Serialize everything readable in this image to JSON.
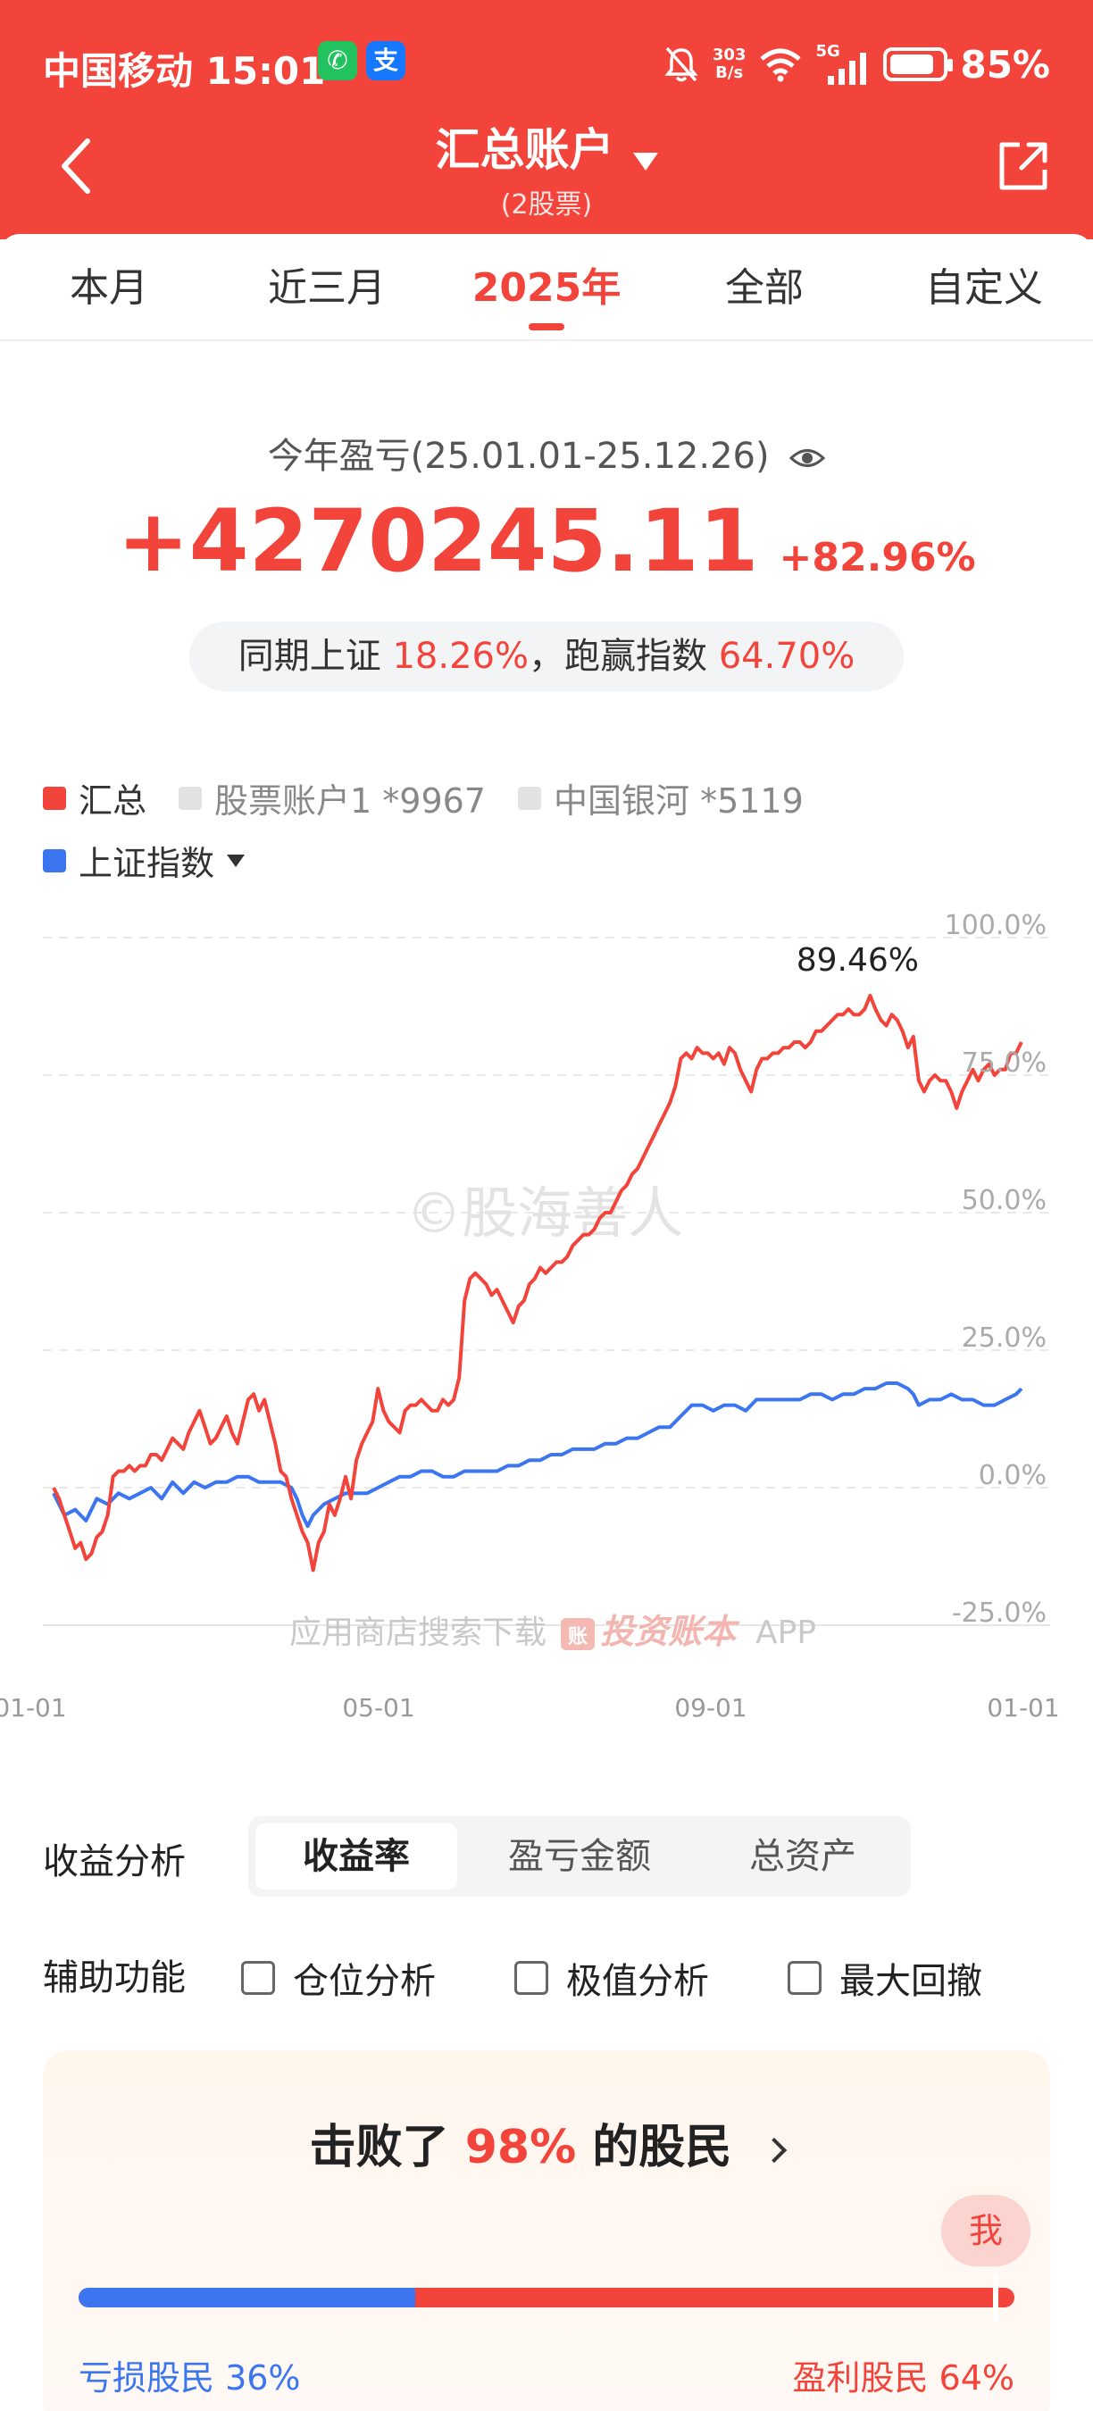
{
  "status_bar": {
    "carrier": "中国移动",
    "time": "15:01",
    "net_speed_value": "303",
    "net_speed_unit": "B/s",
    "network_type": "5G",
    "battery_percent": "85%",
    "battery_level": 0.85,
    "icons": [
      "wechat-icon",
      "alipay-icon",
      "mute-bell-icon",
      "wifi-icon",
      "signal-icon",
      "battery-icon"
    ]
  },
  "nav": {
    "title": "汇总账户",
    "subtitle": "(2股票)",
    "wechat_glyph": "✆",
    "alipay_glyph": "支"
  },
  "tabs": [
    {
      "label": "本月"
    },
    {
      "label": "近三月"
    },
    {
      "label": "2025年",
      "active": true
    },
    {
      "label": "全部"
    },
    {
      "label": "自定义"
    }
  ],
  "summary": {
    "period_label": "今年盈亏(25.01.01-25.12.26)",
    "profit_amount": "+4270245.11",
    "profit_percent": "+82.96%",
    "compare_prefix": "同期上证",
    "index_return": "18.26%",
    "compare_mid": "，跑赢指数",
    "outperform": "64.70%"
  },
  "legend": {
    "total_label": "汇总",
    "account1_label": "股票账户1 *9967",
    "account2_label": "中国银河 *5119",
    "index_label": "上证指数"
  },
  "colors": {
    "brand_red": "#f2443a",
    "index_blue": "#3b76f0",
    "muted_grey": "#dddddd"
  },
  "chart_data": {
    "type": "line",
    "title": "",
    "xlabel": "",
    "ylabel": "",
    "x_ticks": [
      "01-01",
      "05-01",
      "09-01",
      "01-01"
    ],
    "y_ticks": [
      "100.0%",
      "75.0%",
      "50.0%",
      "25.0%",
      "0.0%",
      "-25.0%"
    ],
    "ylim": [
      -25,
      100
    ],
    "x_domain": [
      0,
      360
    ],
    "peak_label": "89.46%",
    "peak_value": 89.46,
    "peak_day": 302,
    "watermark": "©股海善人",
    "promo_text": "应用商店搜索下载",
    "promo_brand": "投资账本",
    "promo_suffix": "APP",
    "promo_badge": "账",
    "series": [
      {
        "name": "汇总",
        "color": "#f2443a",
        "points": [
          [
            0,
            0
          ],
          [
            2,
            -2
          ],
          [
            4,
            -5
          ],
          [
            6,
            -8
          ],
          [
            8,
            -11
          ],
          [
            10,
            -10
          ],
          [
            12,
            -13
          ],
          [
            14,
            -12
          ],
          [
            16,
            -9
          ],
          [
            18,
            -8
          ],
          [
            20,
            -5
          ],
          [
            22,
            2
          ],
          [
            24,
            3
          ],
          [
            26,
            3
          ],
          [
            28,
            4
          ],
          [
            30,
            3
          ],
          [
            32,
            4
          ],
          [
            34,
            4
          ],
          [
            36,
            6
          ],
          [
            38,
            6
          ],
          [
            40,
            5
          ],
          [
            42,
            7
          ],
          [
            44,
            9
          ],
          [
            46,
            8
          ],
          [
            48,
            7
          ],
          [
            50,
            10
          ],
          [
            52,
            12
          ],
          [
            54,
            14
          ],
          [
            56,
            11
          ],
          [
            58,
            8
          ],
          [
            60,
            9
          ],
          [
            62,
            11
          ],
          [
            64,
            13
          ],
          [
            66,
            10
          ],
          [
            68,
            8
          ],
          [
            70,
            12
          ],
          [
            72,
            16
          ],
          [
            74,
            17
          ],
          [
            76,
            14
          ],
          [
            78,
            16
          ],
          [
            80,
            12
          ],
          [
            82,
            8
          ],
          [
            84,
            3
          ],
          [
            86,
            2
          ],
          [
            88,
            -2
          ],
          [
            90,
            -5
          ],
          [
            92,
            -8
          ],
          [
            94,
            -10
          ],
          [
            96,
            -15
          ],
          [
            98,
            -10
          ],
          [
            100,
            -8
          ],
          [
            102,
            -3
          ],
          [
            104,
            -5
          ],
          [
            106,
            -2
          ],
          [
            108,
            2
          ],
          [
            110,
            -2
          ],
          [
            112,
            5
          ],
          [
            114,
            8
          ],
          [
            116,
            10
          ],
          [
            118,
            12
          ],
          [
            120,
            18
          ],
          [
            122,
            14
          ],
          [
            124,
            12
          ],
          [
            126,
            11
          ],
          [
            128,
            10
          ],
          [
            130,
            14
          ],
          [
            132,
            15
          ],
          [
            134,
            15
          ],
          [
            136,
            16
          ],
          [
            138,
            15
          ],
          [
            140,
            14
          ],
          [
            142,
            14
          ],
          [
            144,
            16
          ],
          [
            146,
            15
          ],
          [
            148,
            16
          ],
          [
            150,
            20
          ],
          [
            152,
            34
          ],
          [
            154,
            38
          ],
          [
            156,
            39
          ],
          [
            158,
            38
          ],
          [
            160,
            37
          ],
          [
            162,
            35
          ],
          [
            164,
            36
          ],
          [
            166,
            34
          ],
          [
            168,
            32
          ],
          [
            170,
            30
          ],
          [
            172,
            33
          ],
          [
            174,
            34
          ],
          [
            176,
            37
          ],
          [
            178,
            38
          ],
          [
            180,
            40
          ],
          [
            182,
            39
          ],
          [
            184,
            40
          ],
          [
            186,
            41
          ],
          [
            188,
            41
          ],
          [
            190,
            42
          ],
          [
            192,
            44
          ],
          [
            194,
            45
          ],
          [
            196,
            46
          ],
          [
            198,
            46
          ],
          [
            200,
            47
          ],
          [
            202,
            49
          ],
          [
            204,
            50
          ],
          [
            206,
            50
          ],
          [
            208,
            52
          ],
          [
            210,
            54
          ],
          [
            212,
            55
          ],
          [
            214,
            57
          ],
          [
            216,
            58
          ],
          [
            218,
            60
          ],
          [
            220,
            62
          ],
          [
            222,
            64
          ],
          [
            224,
            66
          ],
          [
            226,
            68
          ],
          [
            228,
            70
          ],
          [
            230,
            73
          ],
          [
            232,
            78
          ],
          [
            234,
            79
          ],
          [
            236,
            78
          ],
          [
            238,
            80
          ],
          [
            240,
            79
          ],
          [
            242,
            79
          ],
          [
            244,
            78
          ],
          [
            246,
            79
          ],
          [
            248,
            77
          ],
          [
            250,
            80
          ],
          [
            252,
            79
          ],
          [
            254,
            76
          ],
          [
            256,
            74
          ],
          [
            258,
            72
          ],
          [
            260,
            76
          ],
          [
            262,
            78
          ],
          [
            264,
            78
          ],
          [
            266,
            79
          ],
          [
            268,
            79
          ],
          [
            270,
            80
          ],
          [
            272,
            80
          ],
          [
            274,
            81
          ],
          [
            276,
            81
          ],
          [
            278,
            80
          ],
          [
            280,
            81
          ],
          [
            282,
            83
          ],
          [
            284,
            83
          ],
          [
            286,
            84
          ],
          [
            288,
            85
          ],
          [
            290,
            86
          ],
          [
            292,
            86
          ],
          [
            294,
            87
          ],
          [
            296,
            86
          ],
          [
            298,
            86
          ],
          [
            300,
            87
          ],
          [
            302,
            89.46
          ],
          [
            304,
            87
          ],
          [
            306,
            85
          ],
          [
            308,
            84
          ],
          [
            310,
            86
          ],
          [
            312,
            85
          ],
          [
            314,
            83
          ],
          [
            316,
            80
          ],
          [
            318,
            82
          ],
          [
            320,
            74
          ],
          [
            322,
            72
          ],
          [
            324,
            74
          ],
          [
            326,
            75
          ],
          [
            328,
            74
          ],
          [
            330,
            74
          ],
          [
            332,
            72
          ],
          [
            334,
            69
          ],
          [
            336,
            72
          ],
          [
            338,
            74
          ],
          [
            340,
            76
          ],
          [
            342,
            74
          ],
          [
            344,
            76
          ],
          [
            346,
            77
          ],
          [
            348,
            75
          ],
          [
            350,
            76
          ],
          [
            352,
            76
          ],
          [
            354,
            79
          ],
          [
            356,
            79
          ],
          [
            358,
            81
          ]
        ]
      },
      {
        "name": "上证指数",
        "color": "#3b76f0",
        "points": [
          [
            0,
            -1
          ],
          [
            4,
            -5
          ],
          [
            8,
            -4
          ],
          [
            12,
            -6
          ],
          [
            16,
            -2
          ],
          [
            20,
            -3
          ],
          [
            24,
            -1
          ],
          [
            28,
            -2
          ],
          [
            32,
            -1
          ],
          [
            36,
            0
          ],
          [
            40,
            -2
          ],
          [
            44,
            1
          ],
          [
            48,
            -1
          ],
          [
            52,
            1
          ],
          [
            56,
            0
          ],
          [
            60,
            1
          ],
          [
            64,
            1
          ],
          [
            68,
            2
          ],
          [
            72,
            2
          ],
          [
            76,
            1
          ],
          [
            80,
            1
          ],
          [
            84,
            1
          ],
          [
            88,
            0
          ],
          [
            90,
            -2
          ],
          [
            92,
            -5
          ],
          [
            94,
            -7
          ],
          [
            96,
            -5
          ],
          [
            100,
            -3
          ],
          [
            104,
            -2
          ],
          [
            108,
            -1
          ],
          [
            112,
            -1
          ],
          [
            116,
            -1
          ],
          [
            120,
            0
          ],
          [
            124,
            1
          ],
          [
            128,
            2
          ],
          [
            132,
            2
          ],
          [
            136,
            3
          ],
          [
            140,
            3
          ],
          [
            144,
            2
          ],
          [
            148,
            2
          ],
          [
            152,
            3
          ],
          [
            156,
            3
          ],
          [
            160,
            3
          ],
          [
            164,
            3
          ],
          [
            168,
            4
          ],
          [
            172,
            4
          ],
          [
            176,
            5
          ],
          [
            180,
            5
          ],
          [
            184,
            6
          ],
          [
            188,
            6
          ],
          [
            192,
            7
          ],
          [
            196,
            7
          ],
          [
            200,
            7
          ],
          [
            204,
            8
          ],
          [
            208,
            8
          ],
          [
            212,
            9
          ],
          [
            216,
            9
          ],
          [
            220,
            10
          ],
          [
            224,
            11
          ],
          [
            228,
            11
          ],
          [
            232,
            13
          ],
          [
            236,
            15
          ],
          [
            240,
            15
          ],
          [
            244,
            14
          ],
          [
            248,
            15
          ],
          [
            252,
            15
          ],
          [
            256,
            14
          ],
          [
            260,
            16
          ],
          [
            264,
            16
          ],
          [
            268,
            16
          ],
          [
            272,
            16
          ],
          [
            276,
            16
          ],
          [
            280,
            17
          ],
          [
            284,
            17
          ],
          [
            288,
            16
          ],
          [
            292,
            17
          ],
          [
            296,
            17
          ],
          [
            300,
            18
          ],
          [
            304,
            18
          ],
          [
            308,
            19
          ],
          [
            312,
            19
          ],
          [
            316,
            18
          ],
          [
            318,
            17
          ],
          [
            320,
            15
          ],
          [
            324,
            16
          ],
          [
            328,
            16
          ],
          [
            332,
            17
          ],
          [
            336,
            16
          ],
          [
            340,
            16
          ],
          [
            344,
            15
          ],
          [
            348,
            15
          ],
          [
            352,
            16
          ],
          [
            356,
            17
          ],
          [
            358,
            18
          ]
        ]
      }
    ]
  },
  "analysis": {
    "label": "收益分析",
    "options": [
      "收益率",
      "盈亏金额",
      "总资产"
    ],
    "selected": "收益率"
  },
  "tools": {
    "label": "辅助功能",
    "options": [
      "仓位分析",
      "极值分析",
      "最大回撤"
    ]
  },
  "ranking": {
    "title_prefix": "击败了",
    "beat_percent": "98%",
    "title_suffix": "的股民",
    "me_label": "我",
    "user_position": 0.98,
    "loss_share": 0.36,
    "loss_label": "亏损股民 36%",
    "win_label": "盈利股民 64%"
  }
}
